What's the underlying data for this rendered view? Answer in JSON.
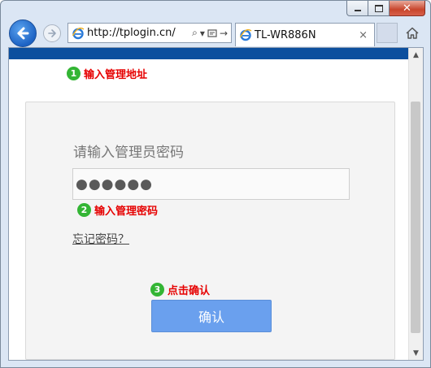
{
  "browser": {
    "address_url": "http://tplogin.cn/",
    "tab_title": "TL-WR886N",
    "tab_close_glyph": "×",
    "search_icon_glyph": "⌕",
    "dropdown_glyph": "▾",
    "go_glyph": "→"
  },
  "window": {
    "close_glyph": "✕"
  },
  "page": {
    "step1": {
      "number": "1",
      "label": "输入管理地址"
    },
    "password_title": "请输入管理员密码",
    "password_value": "●●●●●●",
    "step2": {
      "number": "2",
      "label": "输入管理密码"
    },
    "forgot_link": "忘记密码？",
    "step3": {
      "number": "3",
      "label": "点击确认"
    },
    "confirm_button": "确认"
  },
  "colors": {
    "header_bar": "#0c4f9e",
    "step_badge": "#33b534",
    "step_label": "#e60000",
    "confirm_button": "#6aa0ee"
  },
  "scrollbar": {
    "up_glyph": "▲",
    "down_glyph": "▼"
  }
}
